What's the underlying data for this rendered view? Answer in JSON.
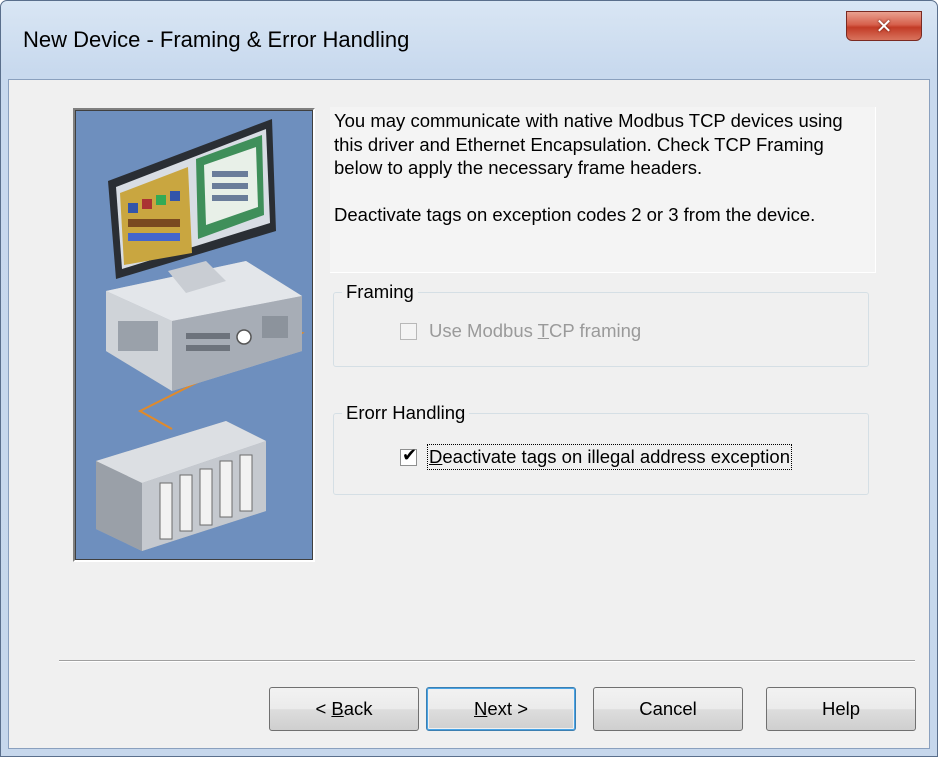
{
  "window": {
    "title": "New Device - Framing & Error Handling",
    "close_icon": "close-icon",
    "colors": {
      "title_bg": "#c8d9ee",
      "close_red": "#c23b26"
    }
  },
  "description": {
    "line1": "You may communicate with native Modbus TCP devices using this driver and Ethernet Encapsulation. Check TCP Framing below to apply the necessary frame headers.",
    "line2": "Deactivate tags on exception codes 2 or 3 from the device."
  },
  "framing": {
    "legend": "Framing",
    "checkbox_label_pre": "Use Modbus ",
    "checkbox_label_accel": "T",
    "checkbox_label_post": "CP framing",
    "checked": false,
    "enabled": false
  },
  "error_handling": {
    "legend": "Erorr Handling",
    "checkbox_label_accel": "D",
    "checkbox_label_post": "eactivate tags on illegal address exception",
    "checked": true,
    "enabled": true
  },
  "buttons": {
    "back_pre": "< ",
    "back_accel": "B",
    "back_post": "ack",
    "next_accel": "N",
    "next_post": "ext >",
    "cancel": "Cancel",
    "help": "Help"
  },
  "illustration": {
    "icon": "computer-and-plc-illustration",
    "background": "#6e8fbe"
  }
}
